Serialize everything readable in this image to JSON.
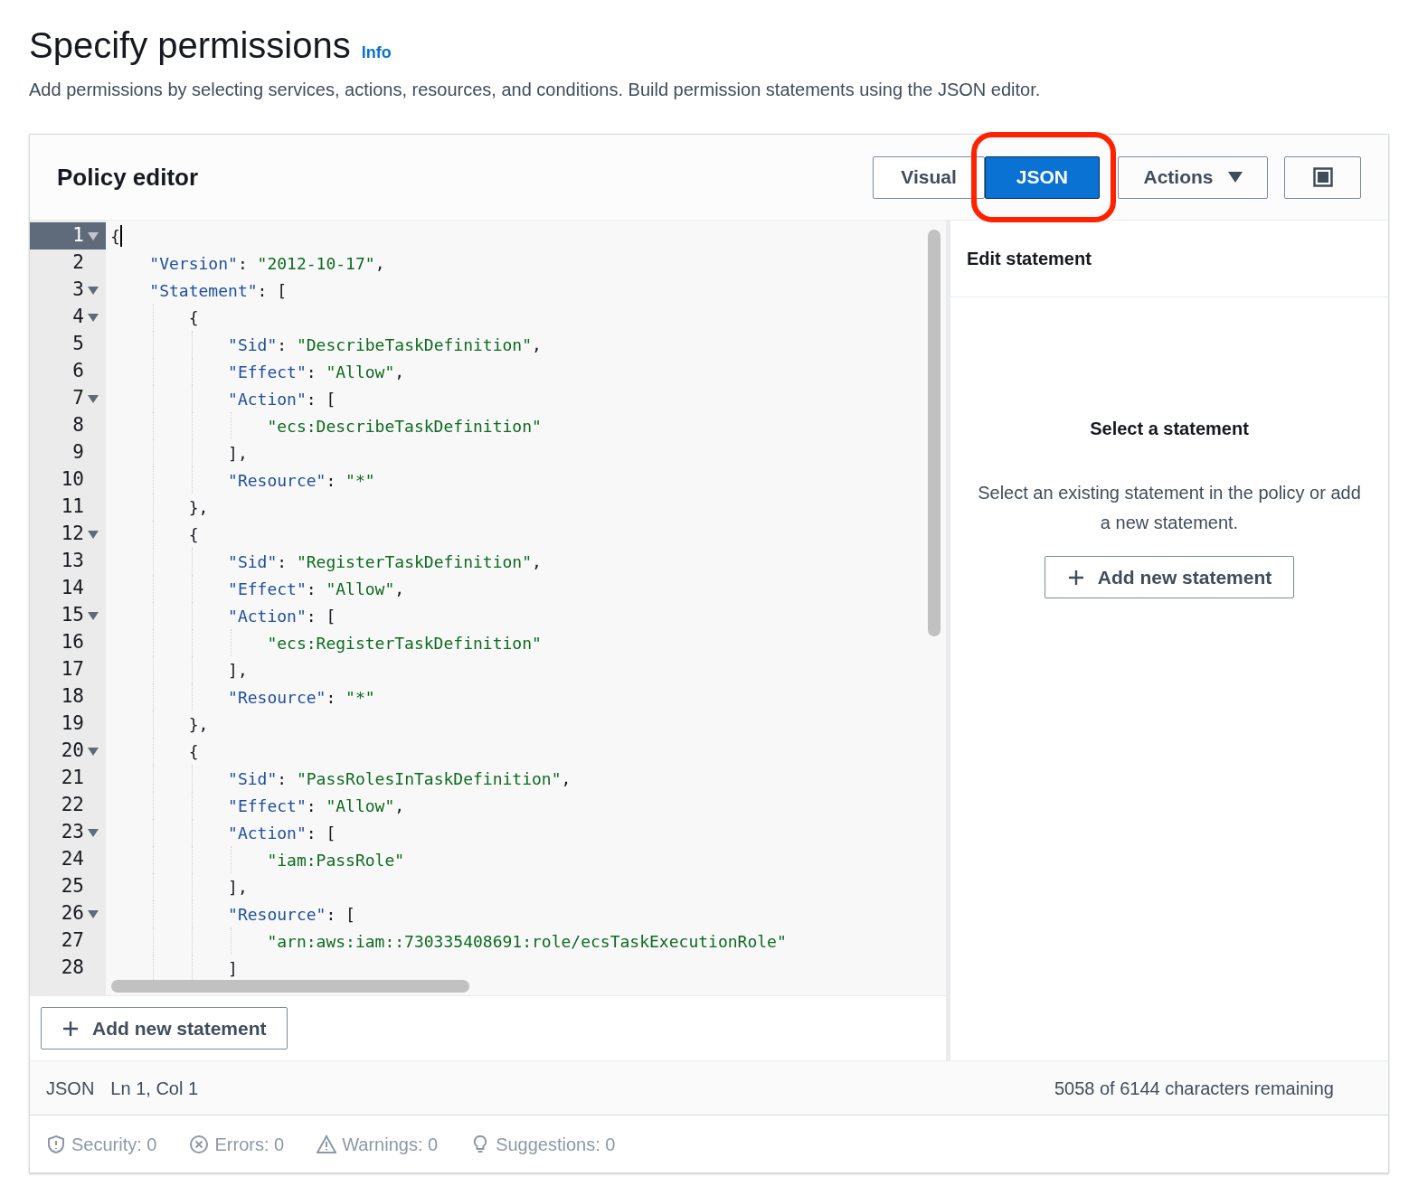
{
  "header": {
    "title": "Specify permissions",
    "info_link": "Info",
    "description": "Add permissions by selecting services, actions, resources, and conditions. Build permission statements using the JSON editor."
  },
  "policy_editor": {
    "title": "Policy editor",
    "modes": [
      {
        "label": "Visual",
        "selected": false,
        "annotated": false
      },
      {
        "label": "JSON",
        "selected": true,
        "annotated": true
      }
    ],
    "actions_button": "Actions",
    "code_lines": [
      {
        "number": "1",
        "fold": true,
        "active": true,
        "tokens": [
          {
            "kind": "punct",
            "text": "{"
          }
        ]
      },
      {
        "number": "2",
        "fold": false,
        "active": false,
        "tokens": [
          {
            "kind": "key",
            "text": "    \"Version\""
          },
          {
            "kind": "punct",
            "text": ": "
          },
          {
            "kind": "string",
            "text": "\"2012-10-17\""
          },
          {
            "kind": "punct",
            "text": ","
          }
        ]
      },
      {
        "number": "3",
        "fold": true,
        "active": false,
        "tokens": [
          {
            "kind": "key",
            "text": "    \"Statement\""
          },
          {
            "kind": "punct",
            "text": ": ["
          }
        ]
      },
      {
        "number": "4",
        "fold": true,
        "active": false,
        "tokens": [
          {
            "kind": "punct",
            "text": "        {"
          }
        ]
      },
      {
        "number": "5",
        "fold": false,
        "active": false,
        "tokens": [
          {
            "kind": "key",
            "text": "            \"Sid\""
          },
          {
            "kind": "punct",
            "text": ": "
          },
          {
            "kind": "string",
            "text": "\"DescribeTaskDefinition\""
          },
          {
            "kind": "punct",
            "text": ","
          }
        ]
      },
      {
        "number": "6",
        "fold": false,
        "active": false,
        "tokens": [
          {
            "kind": "key",
            "text": "            \"Effect\""
          },
          {
            "kind": "punct",
            "text": ": "
          },
          {
            "kind": "string",
            "text": "\"Allow\""
          },
          {
            "kind": "punct",
            "text": ","
          }
        ]
      },
      {
        "number": "7",
        "fold": true,
        "active": false,
        "tokens": [
          {
            "kind": "key",
            "text": "            \"Action\""
          },
          {
            "kind": "punct",
            "text": ": ["
          }
        ]
      },
      {
        "number": "8",
        "fold": false,
        "active": false,
        "tokens": [
          {
            "kind": "string",
            "text": "                \"ecs:DescribeTaskDefinition\""
          }
        ]
      },
      {
        "number": "9",
        "fold": false,
        "active": false,
        "tokens": [
          {
            "kind": "punct",
            "text": "            ],"
          }
        ]
      },
      {
        "number": "10",
        "fold": false,
        "active": false,
        "tokens": [
          {
            "kind": "key",
            "text": "            \"Resource\""
          },
          {
            "kind": "punct",
            "text": ": "
          },
          {
            "kind": "string",
            "text": "\"*\""
          }
        ]
      },
      {
        "number": "11",
        "fold": false,
        "active": false,
        "tokens": [
          {
            "kind": "punct",
            "text": "        },"
          }
        ]
      },
      {
        "number": "12",
        "fold": true,
        "active": false,
        "tokens": [
          {
            "kind": "punct",
            "text": "        {"
          }
        ]
      },
      {
        "number": "13",
        "fold": false,
        "active": false,
        "tokens": [
          {
            "kind": "key",
            "text": "            \"Sid\""
          },
          {
            "kind": "punct",
            "text": ": "
          },
          {
            "kind": "string",
            "text": "\"RegisterTaskDefinition\""
          },
          {
            "kind": "punct",
            "text": ","
          }
        ]
      },
      {
        "number": "14",
        "fold": false,
        "active": false,
        "tokens": [
          {
            "kind": "key",
            "text": "            \"Effect\""
          },
          {
            "kind": "punct",
            "text": ": "
          },
          {
            "kind": "string",
            "text": "\"Allow\""
          },
          {
            "kind": "punct",
            "text": ","
          }
        ]
      },
      {
        "number": "15",
        "fold": true,
        "active": false,
        "tokens": [
          {
            "kind": "key",
            "text": "            \"Action\""
          },
          {
            "kind": "punct",
            "text": ": ["
          }
        ]
      },
      {
        "number": "16",
        "fold": false,
        "active": false,
        "tokens": [
          {
            "kind": "string",
            "text": "                \"ecs:RegisterTaskDefinition\""
          }
        ]
      },
      {
        "number": "17",
        "fold": false,
        "active": false,
        "tokens": [
          {
            "kind": "punct",
            "text": "            ],"
          }
        ]
      },
      {
        "number": "18",
        "fold": false,
        "active": false,
        "tokens": [
          {
            "kind": "key",
            "text": "            \"Resource\""
          },
          {
            "kind": "punct",
            "text": ": "
          },
          {
            "kind": "string",
            "text": "\"*\""
          }
        ]
      },
      {
        "number": "19",
        "fold": false,
        "active": false,
        "tokens": [
          {
            "kind": "punct",
            "text": "        },"
          }
        ]
      },
      {
        "number": "20",
        "fold": true,
        "active": false,
        "tokens": [
          {
            "kind": "punct",
            "text": "        {"
          }
        ]
      },
      {
        "number": "21",
        "fold": false,
        "active": false,
        "tokens": [
          {
            "kind": "key",
            "text": "            \"Sid\""
          },
          {
            "kind": "punct",
            "text": ": "
          },
          {
            "kind": "string",
            "text": "\"PassRolesInTaskDefinition\""
          },
          {
            "kind": "punct",
            "text": ","
          }
        ]
      },
      {
        "number": "22",
        "fold": false,
        "active": false,
        "tokens": [
          {
            "kind": "key",
            "text": "            \"Effect\""
          },
          {
            "kind": "punct",
            "text": ": "
          },
          {
            "kind": "string",
            "text": "\"Allow\""
          },
          {
            "kind": "punct",
            "text": ","
          }
        ]
      },
      {
        "number": "23",
        "fold": true,
        "active": false,
        "tokens": [
          {
            "kind": "key",
            "text": "            \"Action\""
          },
          {
            "kind": "punct",
            "text": ": ["
          }
        ]
      },
      {
        "number": "24",
        "fold": false,
        "active": false,
        "tokens": [
          {
            "kind": "string",
            "text": "                \"iam:PassRole\""
          }
        ]
      },
      {
        "number": "25",
        "fold": false,
        "active": false,
        "tokens": [
          {
            "kind": "punct",
            "text": "            ],"
          }
        ]
      },
      {
        "number": "26",
        "fold": true,
        "active": false,
        "tokens": [
          {
            "kind": "key",
            "text": "            \"Resource\""
          },
          {
            "kind": "punct",
            "text": ": ["
          }
        ]
      },
      {
        "number": "27",
        "fold": false,
        "active": false,
        "tokens": [
          {
            "kind": "string",
            "text": "                \"arn:aws:iam::730335408691:role/ecsTaskExecutionRole\""
          }
        ]
      },
      {
        "number": "28",
        "fold": false,
        "active": false,
        "tokens": [
          {
            "kind": "punct",
            "text": "            ]"
          }
        ]
      }
    ],
    "add_statement_button": "Add new statement",
    "side_panel": {
      "title": "Edit statement",
      "empty_title": "Select a statement",
      "empty_text": "Select an existing statement in the policy or add a new statement.",
      "add_button": "Add new statement"
    },
    "status_bar": {
      "language": "JSON",
      "position": "Ln 1, Col 1",
      "remaining": "5058 of 6144 characters remaining"
    },
    "findings": [
      {
        "kind": "security",
        "label": "Security: 0"
      },
      {
        "kind": "errors",
        "label": "Errors: 0"
      },
      {
        "kind": "warnings",
        "label": "Warnings: 0"
      },
      {
        "kind": "suggestions",
        "label": "Suggestions: 0"
      }
    ]
  }
}
